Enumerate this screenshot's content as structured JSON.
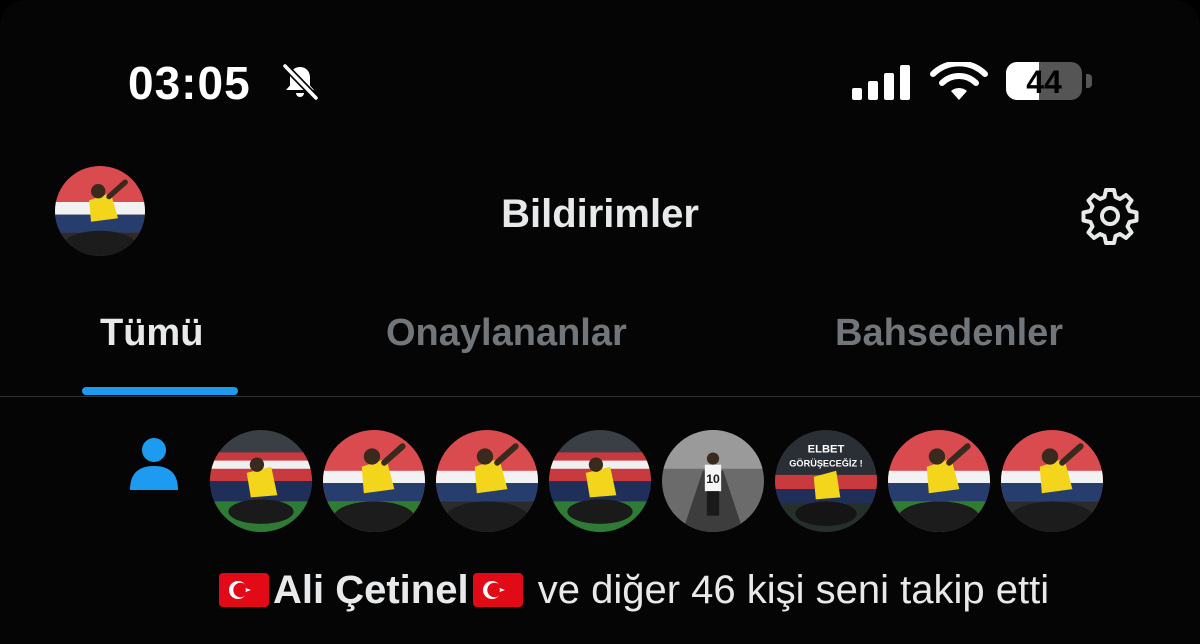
{
  "status_bar": {
    "time": "03:05",
    "icons": [
      "bell-slash-icon",
      "signal-icon",
      "wifi-icon",
      "battery-icon"
    ],
    "battery": "44",
    "battery_level": 0.44
  },
  "header": {
    "title": "Bildirimler",
    "avatar": "profile-avatar",
    "settings_icon": "gear-icon"
  },
  "tabs": [
    {
      "label": "Tümü",
      "active": true
    },
    {
      "label": "Onaylananlar",
      "active": false
    },
    {
      "label": "Bahsedenler",
      "active": false
    }
  ],
  "notification": {
    "icon": "person-icon",
    "name": "Ali Çetinel",
    "message": "ve diğer 46 kişi seni takip etti",
    "flag": "turkey-flag",
    "avatar_overlay_text": "ELBET GÖRÜŞECEĞİZ !"
  },
  "colors": {
    "accent": "#1d9bf0",
    "background": "#000000",
    "text_primary": "#e7e9ea",
    "text_secondary": "#71767b"
  }
}
